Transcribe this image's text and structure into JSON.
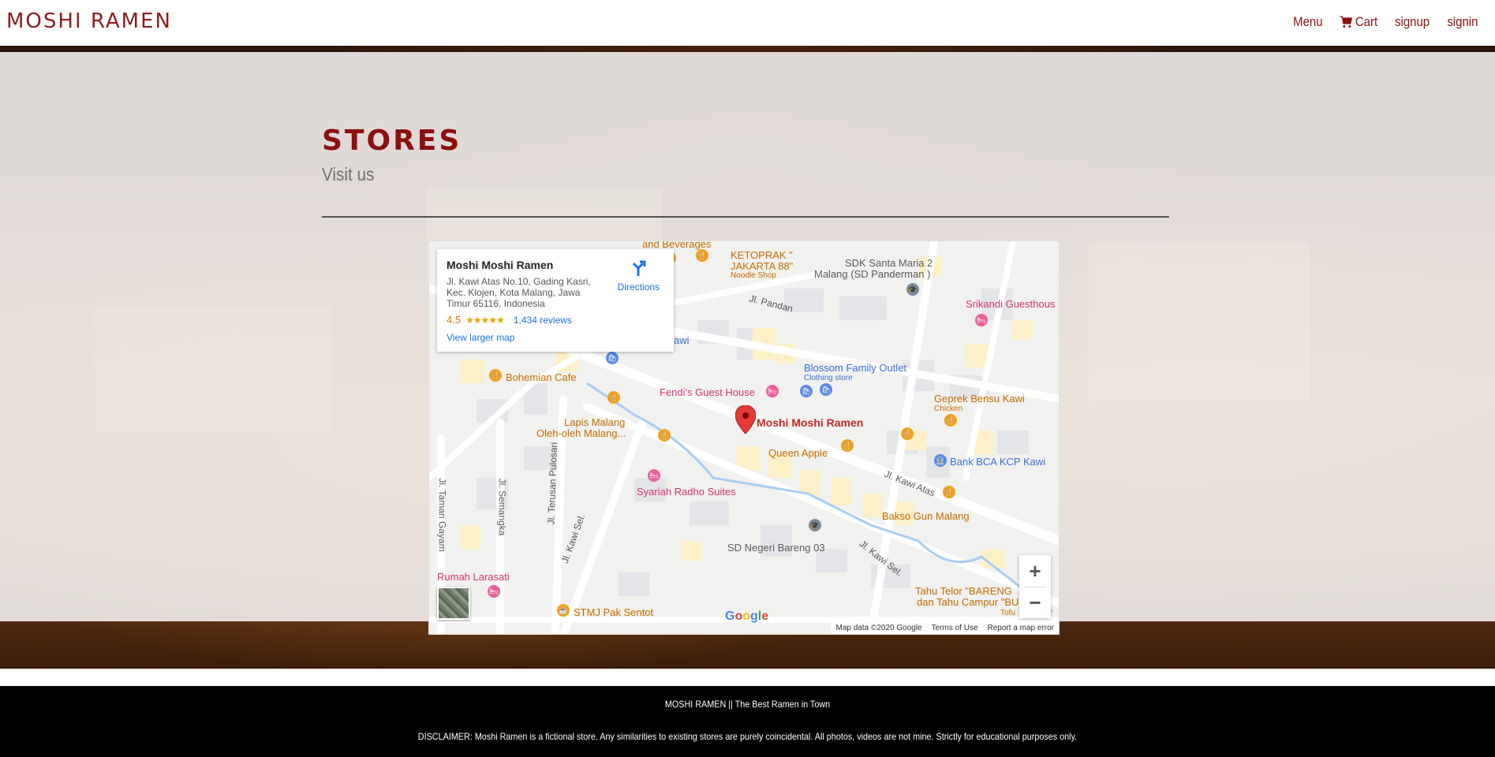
{
  "brand": {
    "name": "MOSHI RAMEN"
  },
  "nav": {
    "menu": "Menu",
    "cart": "Cart",
    "signup": "signup",
    "signin": "signin",
    "cart_icon": "shopping-cart-icon"
  },
  "page": {
    "title": "STORES",
    "subtitle": "Visit us"
  },
  "map": {
    "place_name": "Moshi Moshi Ramen",
    "address": "Jl. Kawi Atas No.10, Gading Kasri, Kec. Klojen, Kota Malang, Jawa Timur 65116, Indonesia",
    "rating": "4.5",
    "stars": "★★★★★",
    "reviews": "1,434 reviews",
    "larger_map": "View larger map",
    "directions": "Directions",
    "marker_label": "Moshi Moshi Ramen",
    "pois": {
      "and_beverages": "and Beverages",
      "ketoprak": "KETOPRAK \"",
      "jakarta": "JAKARTA 88\"",
      "noodle_shop": "Noodle Shop",
      "sdk_santa": "SDK Santa Maria 2",
      "sdk_santa2": "Malang (SD Panderman )",
      "srikandi": "Srikandi Guesthous",
      "bohemian": "Bohemian Cafe",
      "blossom": "Blossom Family Outlet",
      "clothing": "Clothing store",
      "fendis": "Fendi's Guest House",
      "geprek": "Geprek Bensu Kawi",
      "chicken": "Chicken",
      "lapis": "Lapis Malang",
      "oleh": "Oleh-oleh Malang...",
      "queen": "Queen Apple",
      "bca": "Bank BCA KCP Kawi",
      "syariah": "Syariah Radho Suites",
      "bakso": "Bakso Gun Malang",
      "sd_negeri": "SD Negeri Bareng 03",
      "rumah": "Rumah Larasati",
      "stmj": "STMJ Pak Sentot",
      "tahu1": "Tahu Telor \"BARENG",
      "tahu2": "dan Tahu Campur \"BU",
      "tofu": "Tofu",
      "awi": "awi"
    },
    "roads": {
      "pandan": "Jl. Pandan",
      "kawi_atas": "Jl. Kawi Atas",
      "kawi_sel_1": "Jl. Kawi Sel.",
      "kawi_sel_2": "Jl. Kawi Sel.",
      "semangka": "Jl. Semangka",
      "pulosari": "Jl. Terusan Pulosari",
      "taman_gayam": "Jl. Taman Gayam"
    },
    "google": "Google",
    "footer": {
      "data": "Map data ©2020 Google",
      "terms": "Terms of Use",
      "report": "Report a map error"
    },
    "zoom_in": "+",
    "zoom_out": "−"
  },
  "footer": {
    "tagline": "MOSHI RAMEN || The Best Ramen in Town",
    "disclaimer": "DISCLAIMER: Moshi Ramen is a fictional store. Any similarities to existing stores are purely coincidental. All photos, videos are not mine. Strictly for educational purposes only."
  },
  "colors": {
    "brand": "#8b1010",
    "footer_bg": "#000000"
  }
}
